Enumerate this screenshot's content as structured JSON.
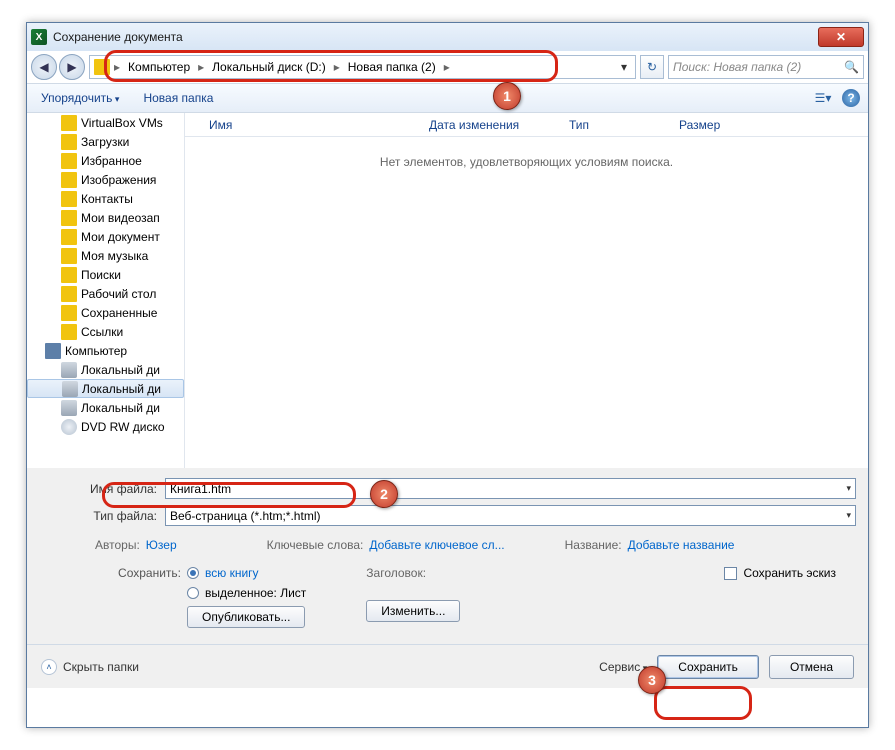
{
  "window": {
    "title": "Сохранение документа"
  },
  "breadcrumb": {
    "items": [
      "Компьютер",
      "Локальный диск (D:)",
      "Новая папка (2)"
    ]
  },
  "search": {
    "placeholder": "Поиск: Новая папка (2)"
  },
  "toolbar": {
    "organize": "Упорядочить",
    "new_folder": "Новая папка"
  },
  "sidebar": {
    "items": [
      {
        "label": "VirtualBox VMs",
        "cls": "folder",
        "lvl": 2
      },
      {
        "label": "Загрузки",
        "cls": "spec",
        "lvl": 2
      },
      {
        "label": "Избранное",
        "cls": "spec",
        "lvl": 2
      },
      {
        "label": "Изображения",
        "cls": "spec",
        "lvl": 2
      },
      {
        "label": "Контакты",
        "cls": "spec",
        "lvl": 2
      },
      {
        "label": "Мои видеозап",
        "cls": "spec",
        "lvl": 2
      },
      {
        "label": "Мои документ",
        "cls": "spec",
        "lvl": 2
      },
      {
        "label": "Моя музыка",
        "cls": "spec",
        "lvl": 2
      },
      {
        "label": "Поиски",
        "cls": "spec",
        "lvl": 2
      },
      {
        "label": "Рабочий стол",
        "cls": "spec",
        "lvl": 2
      },
      {
        "label": "Сохраненные",
        "cls": "spec",
        "lvl": 2
      },
      {
        "label": "Ссылки",
        "cls": "spec",
        "lvl": 2
      },
      {
        "label": "Компьютер",
        "cls": "comp",
        "lvl": 1
      },
      {
        "label": "Локальный ди",
        "cls": "drive",
        "lvl": 2
      },
      {
        "label": "Локальный ди",
        "cls": "drive",
        "lvl": 2,
        "sel": true
      },
      {
        "label": "Локальный ди",
        "cls": "drive",
        "lvl": 2
      },
      {
        "label": "DVD RW диско",
        "cls": "dvd",
        "lvl": 2
      }
    ]
  },
  "columns": {
    "name": "Имя",
    "modified": "Дата изменения",
    "type": "Тип",
    "size": "Размер"
  },
  "filepane": {
    "empty_message": "Нет элементов, удовлетворяющих условиям поиска."
  },
  "form": {
    "filename_label": "Имя файла:",
    "filename_value": "Книга1.htm",
    "filetype_label": "Тип файла:",
    "filetype_value": "Веб-страница (*.htm;*.html)"
  },
  "meta": {
    "authors_label": "Авторы:",
    "authors_value": "Юзер",
    "keywords_label": "Ключевые слова:",
    "keywords_link": "Добавьте ключевое сл...",
    "title_label": "Название:",
    "title_link": "Добавьте название"
  },
  "save_opts": {
    "save_label": "Сохранить:",
    "whole_book": "всю книгу",
    "selected_sheet": "выделенное: Лист",
    "publish_btn": "Опубликовать...",
    "header_label": "Заголовок:",
    "change_btn": "Изменить...",
    "thumbnail": "Сохранить эскиз"
  },
  "footer": {
    "hide_folders": "Скрыть папки",
    "service": "Сервис",
    "save": "Сохранить",
    "cancel": "Отмена"
  },
  "annotations": {
    "b1": "1",
    "b2": "2",
    "b3": "3"
  }
}
